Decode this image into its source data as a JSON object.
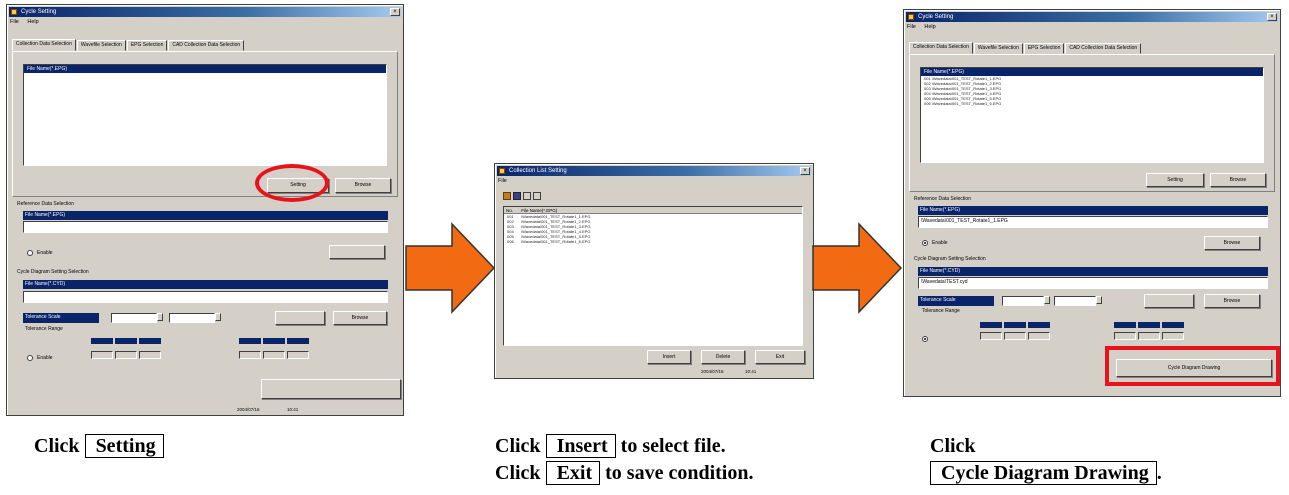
{
  "step1": {
    "window_title": "Cycle Setting",
    "menu": [
      "File",
      "Help"
    ],
    "tabs": [
      "Collection Data Selection",
      "Wavefile Selection",
      "EPG Selection",
      "CAD Collection Data Selection"
    ],
    "list_header": "File Name(*.EPG)",
    "setting_button": "Setting",
    "browse_button": "Browse",
    "reference_label": "Reference Data Selection",
    "reference_header": "File Name(*.EPG)",
    "enable_label": "Enable",
    "cycle_label": "Cycle Diagram Setting Selection",
    "cycle_header": "File Name(*.CYD)",
    "tolerance_label": "Tolerance Scale",
    "threshold_label": "Tolerance Range",
    "browse2_button": "Browse",
    "status": [
      "2004/07/16",
      "10:41"
    ]
  },
  "step2": {
    "window_title": "Collection List Setting",
    "menu": [
      "File"
    ],
    "list_header": [
      "No.",
      "File Name(*.EPG)"
    ],
    "rows": [
      {
        "no": "001",
        "file": "\\Wavedata\\001_TEST_Rotate1_1.EPG"
      },
      {
        "no": "002",
        "file": "\\Wavedata\\001_TEST_Rotate1_2.EPG"
      },
      {
        "no": "003",
        "file": "\\Wavedata\\001_TEST_Rotate1_3.EPG"
      },
      {
        "no": "004",
        "file": "\\Wavedata\\001_TEST_Rotate1_4.EPG"
      },
      {
        "no": "005",
        "file": "\\Wavedata\\001_TEST_Rotate1_5.EPG"
      },
      {
        "no": "006",
        "file": "\\Wavedata\\001_TEST_Rotate1_6.EPG"
      }
    ],
    "insert_button": "Insert",
    "delete_button": "Delete",
    "exit_button": "Exit",
    "status": [
      "2004/07/16",
      "10:41"
    ]
  },
  "step3": {
    "window_title": "Cycle Setting",
    "menu": [
      "File",
      "Help"
    ],
    "tabs": [
      "Collection Data Selection",
      "Wavefile Selection",
      "EPG Selection",
      "CAD Collection Data Selection"
    ],
    "list_header": "File Name(*.EPG)",
    "rows": [
      "001 \\Wavedata\\001_TEST_Rotate1_1.EPG",
      "002 \\Wavedata\\001_TEST_Rotate1_2.EPG",
      "003 \\Wavedata\\001_TEST_Rotate1_3.EPG",
      "004 \\Wavedata\\001_TEST_Rotate1_4.EPG",
      "005 \\Wavedata\\001_TEST_Rotate1_5.EPG",
      "006 \\Wavedata\\001_TEST_Rotate1_6.EPG"
    ],
    "setting_button": "Setting",
    "browse_button": "Browse",
    "reference_label": "Reference Data Selection",
    "reference_header": "File Name(*.EPG)",
    "reference_value": "\\Wavedata\\001_TEST_Rotate1_1.EPG",
    "enable_label": "Enable",
    "browse_ref_button": "Browse",
    "cycle_label": "Cycle Diagram Setting Selection",
    "cycle_header": "File Name(*.CYD)",
    "cycle_value": "\\Wavedata\\TEST.cyd",
    "tolerance_label": "Tolerance Scale",
    "threshold_label": "Tolerance Range",
    "browse2_button": "Browse",
    "drawing_button": "Cycle Diagram Drawing"
  },
  "captions": {
    "c1_prefix": "Click",
    "c1_button": "Setting",
    "c2_line1_prefix": "Click",
    "c2_line1_button": "Insert",
    "c2_line1_suffix": "to select file.",
    "c2_line2_prefix": "Click",
    "c2_line2_button": "Exit",
    "c2_line2_suffix": "to save condition.",
    "c3_prefix": "Click",
    "c3_button": "Cycle Diagram Drawing",
    "c3_suffix": "."
  },
  "colors": {
    "highlight": "#e8121b",
    "arrow": "#f26b12",
    "titlebar": "#0a246a",
    "window": "#d4d0c8"
  }
}
